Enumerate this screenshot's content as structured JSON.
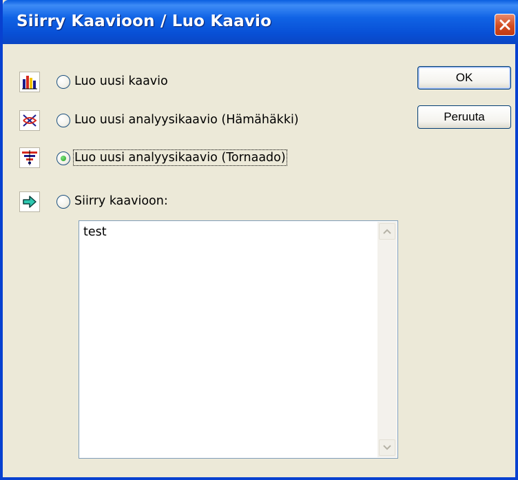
{
  "dialog": {
    "title": "Siirry Kaavioon / Luo Kaavio"
  },
  "options": [
    {
      "icon": "bar-chart-icon",
      "label": "Luo uusi kaavio",
      "selected": false
    },
    {
      "icon": "spider-chart-icon",
      "label": "Luo uusi analyysikaavio (Hämähäkki)",
      "selected": false
    },
    {
      "icon": "tornado-chart-icon",
      "label": "Luo uusi analyysikaavio (Tornaado)",
      "selected": true
    },
    {
      "icon": "arrow-right-icon",
      "label": "Siirry kaavioon:",
      "selected": false
    }
  ],
  "buttons": {
    "ok_label": "OK",
    "cancel_label": "Peruuta"
  },
  "chart_list": {
    "items": [
      "test"
    ]
  },
  "colors": {
    "titlebar": "#0a58dc",
    "close_button": "#d24c21",
    "dialog_background": "#ece9d8",
    "radio_selected_dot": "#21a121"
  }
}
